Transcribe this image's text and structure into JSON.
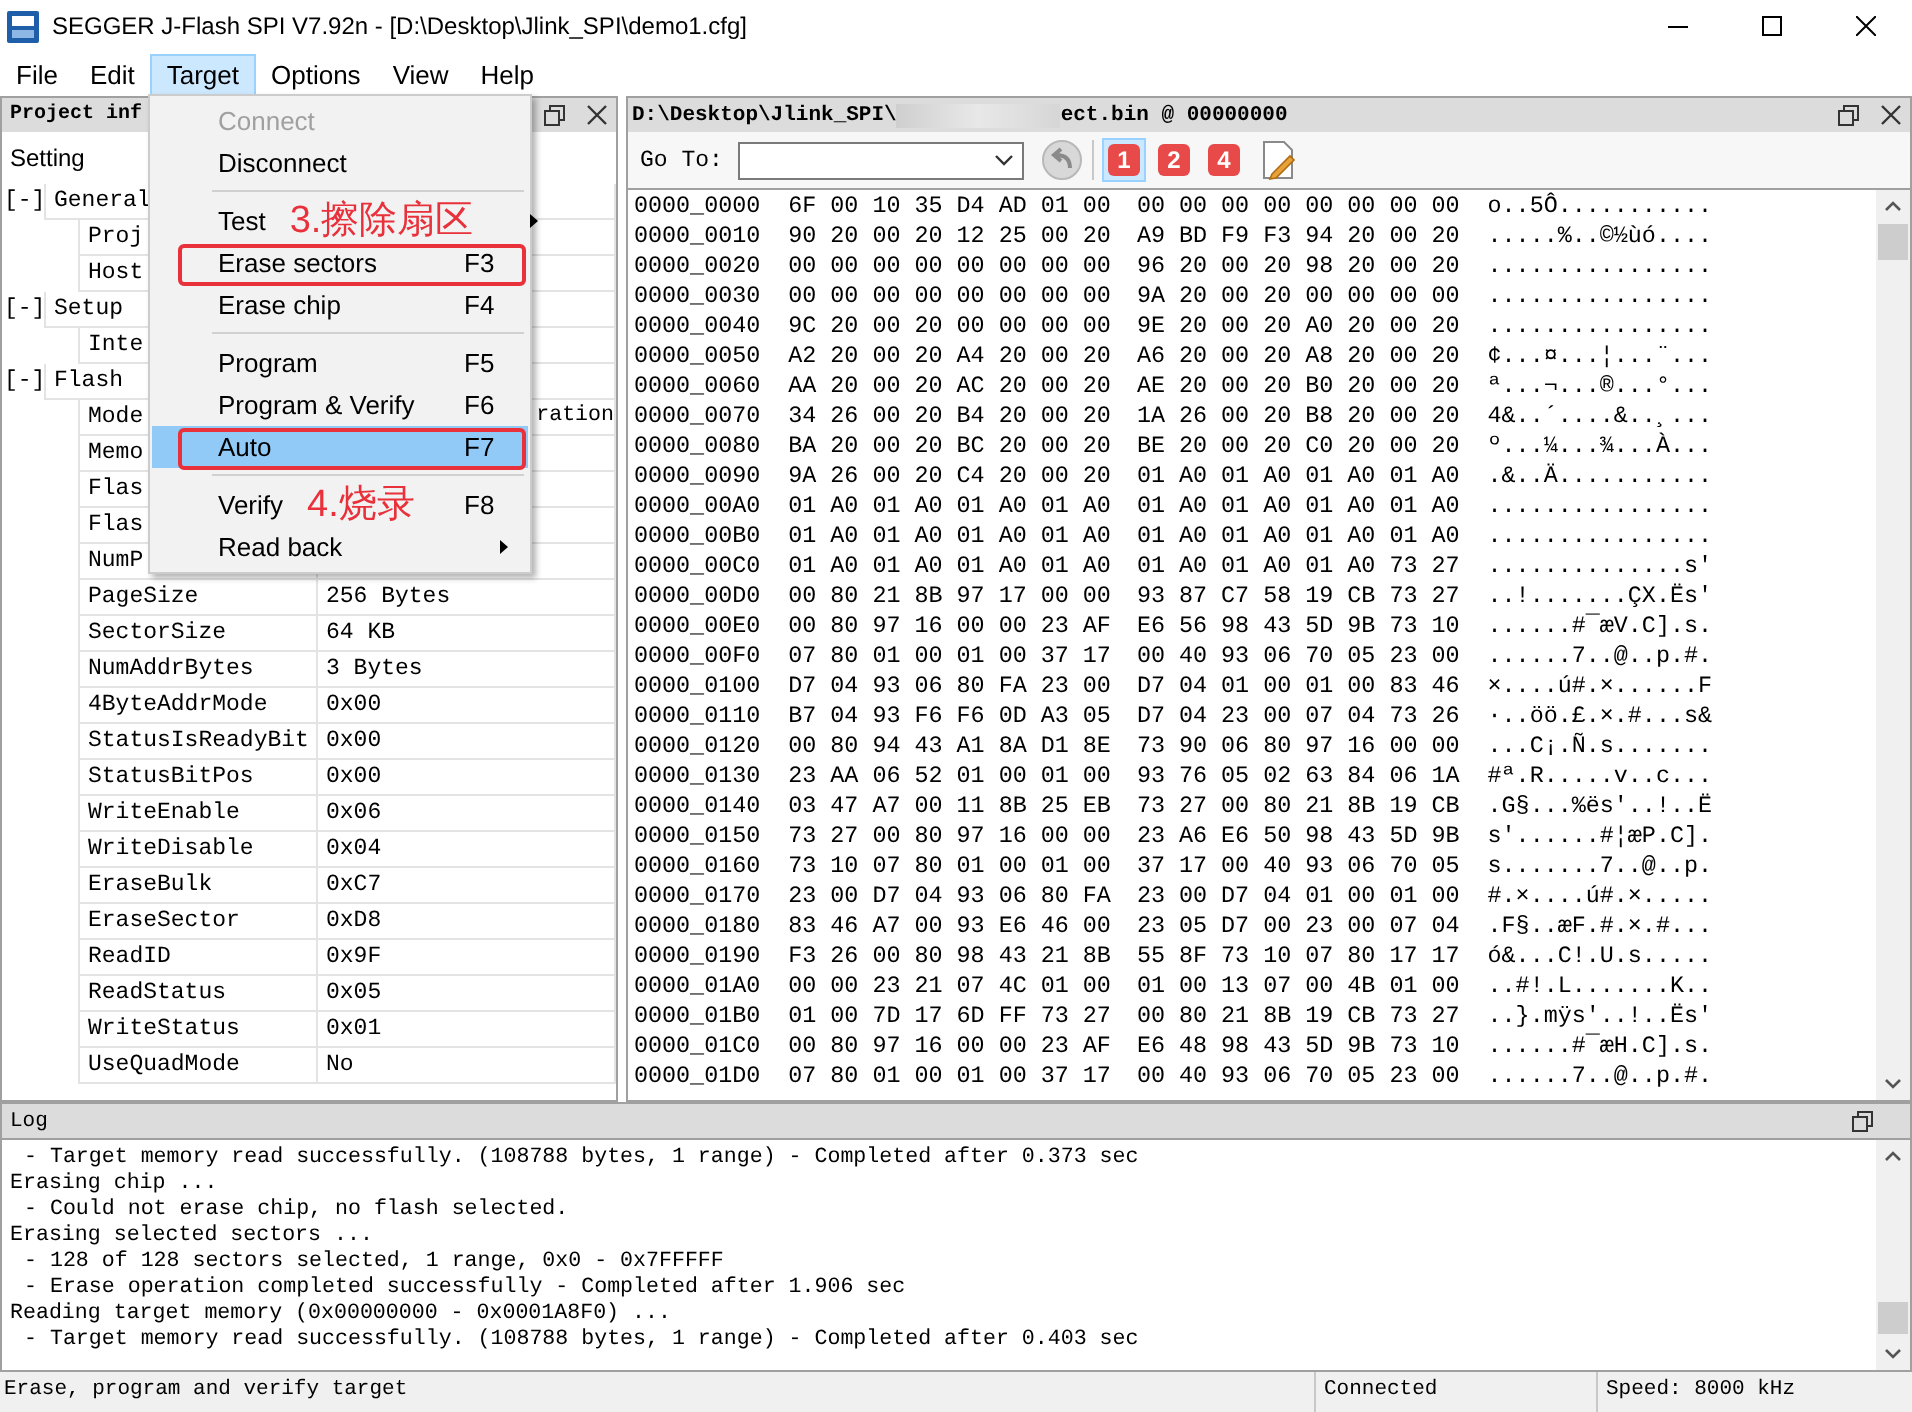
{
  "window": {
    "title": "SEGGER J-Flash SPI V7.92n - [D:\\Desktop\\Jlink_SPI\\demo1.cfg]"
  },
  "menu_bar": [
    {
      "label": "File",
      "selected": false
    },
    {
      "label": "Edit",
      "selected": false
    },
    {
      "label": "Target",
      "selected": true
    },
    {
      "label": "Options",
      "selected": false
    },
    {
      "label": "View",
      "selected": false
    },
    {
      "label": "Help",
      "selected": false
    }
  ],
  "target_menu": {
    "items": [
      {
        "kind": "item",
        "label": "Connect",
        "disabled": true,
        "selected": false,
        "outlined": false
      },
      {
        "kind": "item",
        "label": "Disconnect",
        "disabled": false,
        "selected": false,
        "outlined": false
      },
      {
        "kind": "separator"
      },
      {
        "kind": "submenu",
        "label": "Test",
        "note": "3.擦除扇区",
        "disabled": false,
        "selected": false,
        "outlined": false
      },
      {
        "kind": "item",
        "label": "Erase sectors",
        "shortcut": "F3",
        "disabled": false,
        "selected": false,
        "outlined": true
      },
      {
        "kind": "item",
        "label": "Erase chip",
        "shortcut": "F4",
        "disabled": false,
        "selected": false,
        "outlined": false
      },
      {
        "kind": "separator"
      },
      {
        "kind": "item",
        "label": "Program",
        "shortcut": "F5",
        "disabled": false,
        "selected": false,
        "outlined": false
      },
      {
        "kind": "item",
        "label": "Program & Verify",
        "shortcut": "F6",
        "disabled": false,
        "selected": false,
        "outlined": false
      },
      {
        "kind": "item",
        "label": "Auto",
        "shortcut": "F7",
        "disabled": false,
        "selected": true,
        "outlined": true
      },
      {
        "kind": "separator"
      },
      {
        "kind": "item",
        "label": "Verify",
        "note": "4.烧录",
        "shortcut": "F8",
        "disabled": false,
        "selected": false,
        "outlined": false
      },
      {
        "kind": "submenu",
        "label": "Read back",
        "disabled": false,
        "selected": false,
        "outlined": false
      }
    ]
  },
  "project_panel": {
    "title": "Project inf",
    "column_header": "Setting",
    "groups": [
      {
        "toggle": "[-]",
        "label": "General",
        "children": [
          {
            "kind": "covered",
            "name": "Proj"
          },
          {
            "kind": "covered",
            "name": "Host"
          }
        ]
      },
      {
        "toggle": "[-]",
        "label": "Setup",
        "children": [
          {
            "kind": "covered",
            "name": "Inte"
          }
        ]
      },
      {
        "toggle": "[-]",
        "label": "Flash",
        "children": [
          {
            "kind": "covered",
            "name": "Mode",
            "value": "ration"
          },
          {
            "kind": "covered",
            "name": "Memo"
          },
          {
            "kind": "covered",
            "name": "Flas"
          },
          {
            "kind": "covered",
            "name": "Flas"
          },
          {
            "kind": "covered",
            "name": "NumP"
          },
          {
            "kind": "row",
            "name": "PageSize",
            "value": "256 Bytes"
          },
          {
            "kind": "row",
            "name": "SectorSize",
            "value": "64 KB"
          },
          {
            "kind": "row",
            "name": "NumAddrBytes",
            "value": "3 Bytes"
          },
          {
            "kind": "row",
            "name": "4ByteAddrMode",
            "value": "0x00"
          },
          {
            "kind": "row",
            "name": "StatusIsReadyBit",
            "value": "0x00"
          },
          {
            "kind": "row",
            "name": "StatusBitPos",
            "value": "0x00"
          },
          {
            "kind": "row",
            "name": "WriteEnable",
            "value": "0x06"
          },
          {
            "kind": "row",
            "name": "WriteDisable",
            "value": "0x04"
          },
          {
            "kind": "row",
            "name": "EraseBulk",
            "value": "0xC7"
          },
          {
            "kind": "row",
            "name": "EraseSector",
            "value": "0xD8"
          },
          {
            "kind": "row",
            "name": "ReadID",
            "value": "0x9F"
          },
          {
            "kind": "row",
            "name": "ReadStatus",
            "value": "0x05"
          },
          {
            "kind": "row",
            "name": "WriteStatus",
            "value": "0x01"
          },
          {
            "kind": "row",
            "name": "UseQuadMode",
            "value": "No"
          }
        ]
      }
    ]
  },
  "hex_view": {
    "path_start": "D:\\Desktop\\Jlink_SPI\\",
    "path_end": "ect.bin @ 00000000",
    "goto_label": "Go To:",
    "buttons": [
      {
        "label": "1",
        "selected": true
      },
      {
        "label": "2",
        "selected": false
      },
      {
        "label": "4",
        "selected": false
      }
    ],
    "rows": [
      {
        "address": "0000_0000",
        "bytes_1": "6F 00 10 35 D4 AD 01 00",
        "bytes_2": "00 00 00 00 00 00 00 00",
        "ascii": "o..5Ô..........."
      },
      {
        "address": "0000_0010",
        "bytes_1": "90 20 00 20 12 25 00 20",
        "bytes_2": "A9 BD F9 F3 94 20 00 20",
        "ascii": ".....%..©½ùó...."
      },
      {
        "address": "0000_0020",
        "bytes_1": "00 00 00 00 00 00 00 00",
        "bytes_2": "96 20 00 20 98 20 00 20",
        "ascii": "................"
      },
      {
        "address": "0000_0030",
        "bytes_1": "00 00 00 00 00 00 00 00",
        "bytes_2": "9A 20 00 20 00 00 00 00",
        "ascii": "................"
      },
      {
        "address": "0000_0040",
        "bytes_1": "9C 20 00 20 00 00 00 00",
        "bytes_2": "9E 20 00 20 A0 20 00 20",
        "ascii": "................"
      },
      {
        "address": "0000_0050",
        "bytes_1": "A2 20 00 20 A4 20 00 20",
        "bytes_2": "A6 20 00 20 A8 20 00 20",
        "ascii": "¢...¤...¦...¨..."
      },
      {
        "address": "0000_0060",
        "bytes_1": "AA 20 00 20 AC 20 00 20",
        "bytes_2": "AE 20 00 20 B0 20 00 20",
        "ascii": "ª...¬...®...°..."
      },
      {
        "address": "0000_0070",
        "bytes_1": "34 26 00 20 B4 20 00 20",
        "bytes_2": "1A 26 00 20 B8 20 00 20",
        "ascii": "4&..´....&..¸..."
      },
      {
        "address": "0000_0080",
        "bytes_1": "BA 20 00 20 BC 20 00 20",
        "bytes_2": "BE 20 00 20 C0 20 00 20",
        "ascii": "º...¼...¾...À..."
      },
      {
        "address": "0000_0090",
        "bytes_1": "9A 26 00 20 C4 20 00 20",
        "bytes_2": "01 A0 01 A0 01 A0 01 A0",
        "ascii": ".&..Ä..........."
      },
      {
        "address": "0000_00A0",
        "bytes_1": "01 A0 01 A0 01 A0 01 A0",
        "bytes_2": "01 A0 01 A0 01 A0 01 A0",
        "ascii": "................"
      },
      {
        "address": "0000_00B0",
        "bytes_1": "01 A0 01 A0 01 A0 01 A0",
        "bytes_2": "01 A0 01 A0 01 A0 01 A0",
        "ascii": "................"
      },
      {
        "address": "0000_00C0",
        "bytes_1": "01 A0 01 A0 01 A0 01 A0",
        "bytes_2": "01 A0 01 A0 01 A0 73 27",
        "ascii": "..............s'"
      },
      {
        "address": "0000_00D0",
        "bytes_1": "00 80 21 8B 97 17 00 00",
        "bytes_2": "93 87 C7 58 19 CB 73 27",
        "ascii": "..!.......ÇX.Ës'"
      },
      {
        "address": "0000_00E0",
        "bytes_1": "00 80 97 16 00 00 23 AF",
        "bytes_2": "E6 56 98 43 5D 9B 73 10",
        "ascii": "......#¯æV.C].s."
      },
      {
        "address": "0000_00F0",
        "bytes_1": "07 80 01 00 01 00 37 17",
        "bytes_2": "00 40 93 06 70 05 23 00",
        "ascii": "......7..@..p.#."
      },
      {
        "address": "0000_0100",
        "bytes_1": "D7 04 93 06 80 FA 23 00",
        "bytes_2": "D7 04 01 00 01 00 83 46",
        "ascii": "×....ú#.×......F"
      },
      {
        "address": "0000_0110",
        "bytes_1": "B7 04 93 F6 F6 0D A3 05",
        "bytes_2": "D7 04 23 00 07 04 73 26",
        "ascii": "·..öö.£.×.#...s&"
      },
      {
        "address": "0000_0120",
        "bytes_1": "00 80 94 43 A1 8A D1 8E",
        "bytes_2": "73 90 06 80 97 16 00 00",
        "ascii": "...C¡.Ñ.s......."
      },
      {
        "address": "0000_0130",
        "bytes_1": "23 AA 06 52 01 00 01 00",
        "bytes_2": "93 76 05 02 63 84 06 1A",
        "ascii": "#ª.R.....v..c..."
      },
      {
        "address": "0000_0140",
        "bytes_1": "03 47 A7 00 11 8B 25 EB",
        "bytes_2": "73 27 00 80 21 8B 19 CB",
        "ascii": ".G§...%ës'..!..Ë"
      },
      {
        "address": "0000_0150",
        "bytes_1": "73 27 00 80 97 16 00 00",
        "bytes_2": "23 A6 E6 50 98 43 5D 9B",
        "ascii": "s'......#¦æP.C]."
      },
      {
        "address": "0000_0160",
        "bytes_1": "73 10 07 80 01 00 01 00",
        "bytes_2": "37 17 00 40 93 06 70 05",
        "ascii": "s.......7..@..p."
      },
      {
        "address": "0000_0170",
        "bytes_1": "23 00 D7 04 93 06 80 FA",
        "bytes_2": "23 00 D7 04 01 00 01 00",
        "ascii": "#.×....ú#.×....."
      },
      {
        "address": "0000_0180",
        "bytes_1": "83 46 A7 00 93 E6 46 00",
        "bytes_2": "23 05 D7 00 23 00 07 04",
        "ascii": ".F§..æF.#.×.#..."
      },
      {
        "address": "0000_0190",
        "bytes_1": "F3 26 00 80 98 43 21 8B",
        "bytes_2": "55 8F 73 10 07 80 17 17",
        "ascii": "ó&...C!.U.s....."
      },
      {
        "address": "0000_01A0",
        "bytes_1": "00 00 23 21 07 4C 01 00",
        "bytes_2": "01 00 13 07 00 4B 01 00",
        "ascii": "..#!.L.......K.."
      },
      {
        "address": "0000_01B0",
        "bytes_1": "01 00 7D 17 6D FF 73 27",
        "bytes_2": "00 80 21 8B 19 CB 73 27",
        "ascii": "..}.mÿs'..!..Ës'"
      },
      {
        "address": "0000_01C0",
        "bytes_1": "00 80 97 16 00 00 23 AF",
        "bytes_2": "E6 48 98 43 5D 9B 73 10",
        "ascii": "......#¯æH.C].s."
      },
      {
        "address": "0000_01D0",
        "bytes_1": "07 80 01 00 01 00 37 17",
        "bytes_2": "00 40 93 06 70 05 23 00",
        "ascii": "......7..@..p.#."
      }
    ]
  },
  "log": {
    "title": "Log",
    "lines": [
      {
        "kind": "detail",
        "text": "- Target memory read successfully. (108788 bytes, 1 range) - Completed after 0.373 sec"
      },
      {
        "kind": "step",
        "text": "Erasing chip ..."
      },
      {
        "kind": "detail",
        "text": "- Could not erase chip, no flash selected."
      },
      {
        "kind": "step",
        "text": "Erasing selected sectors ..."
      },
      {
        "kind": "detail",
        "text": "- 128 of 128 sectors selected, 1 range, 0x0 - 0x7FFFFF"
      },
      {
        "kind": "detail",
        "text": "- Erase operation completed successfully - Completed after 1.906 sec"
      },
      {
        "kind": "step",
        "text": "Reading target memory (0x00000000 - 0x0001A8F0) ..."
      },
      {
        "kind": "detail",
        "text": "- Target memory read successfully. (108788 bytes, 1 range) - Completed after 0.403 sec"
      }
    ]
  },
  "status_bar": {
    "message": "Erase, program and verify target",
    "connection": "Connected",
    "speed": "Speed: 8000 kHz"
  }
}
